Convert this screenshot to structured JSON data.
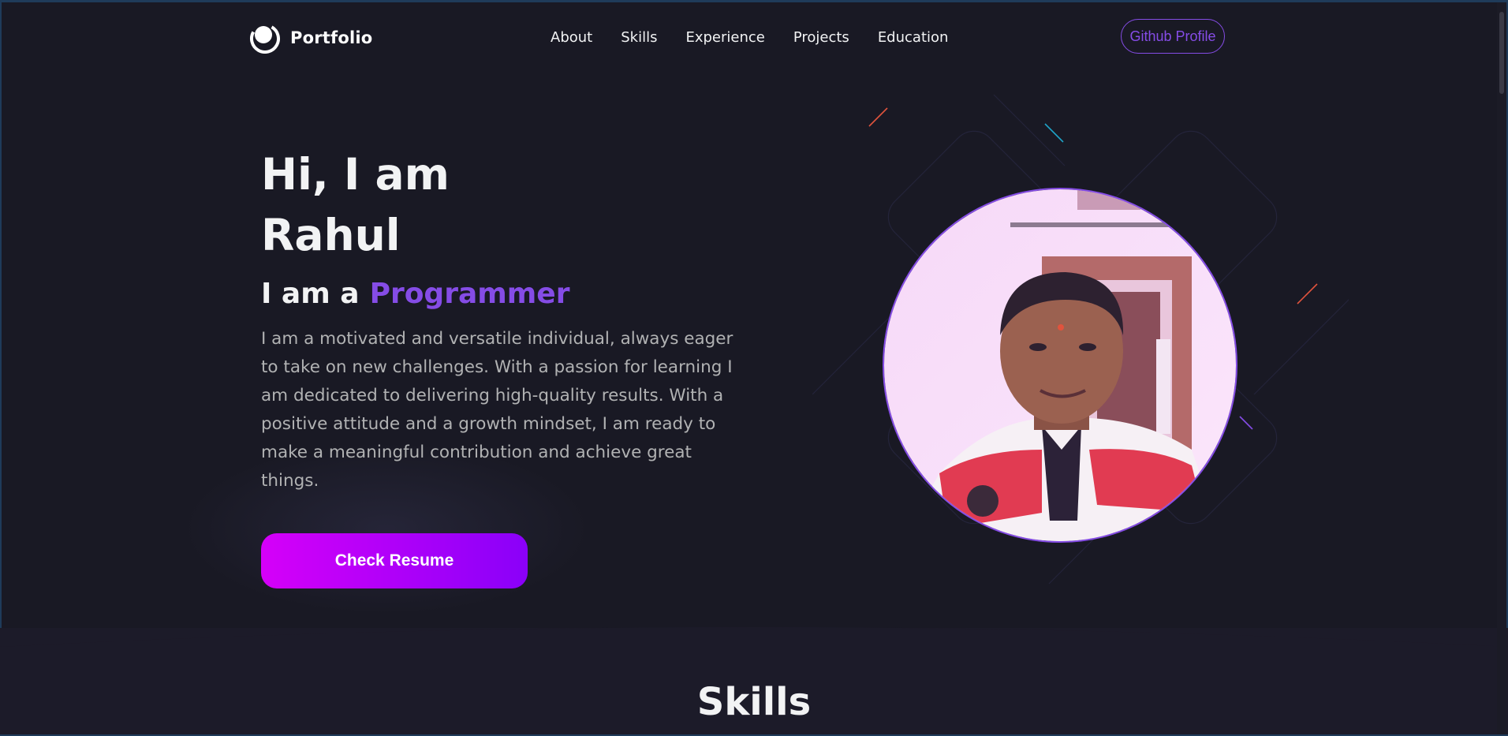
{
  "navbar": {
    "logo_text": "Portfolio",
    "links": [
      "About",
      "Skills",
      "Experience",
      "Projects",
      "Education"
    ],
    "github_button": "Github Profile"
  },
  "hero": {
    "title_line1": "Hi, I am",
    "title_line2": "Rahul",
    "subtitle_prefix": "I am a",
    "subtitle_role": "Programmer",
    "description": "I am a motivated and versatile individual, always eager to take on new challenges. With a passion for learning I am dedicated to delivering high-quality results. With a positive attitude and a growth mindset, I am ready to make a meaningful contribution and achieve great things.",
    "resume_button": "Check Resume"
  },
  "skills": {
    "title": "Skills"
  },
  "colors": {
    "background": "#191924",
    "accent": "#854ce6",
    "text_primary": "#f2f3f4",
    "text_secondary": "#b1b2b3",
    "button_gradient_start": "#d500f9",
    "button_gradient_end": "#8a00f9"
  },
  "icons": {
    "logo": "logo-icon",
    "profile": "profile-photo"
  }
}
